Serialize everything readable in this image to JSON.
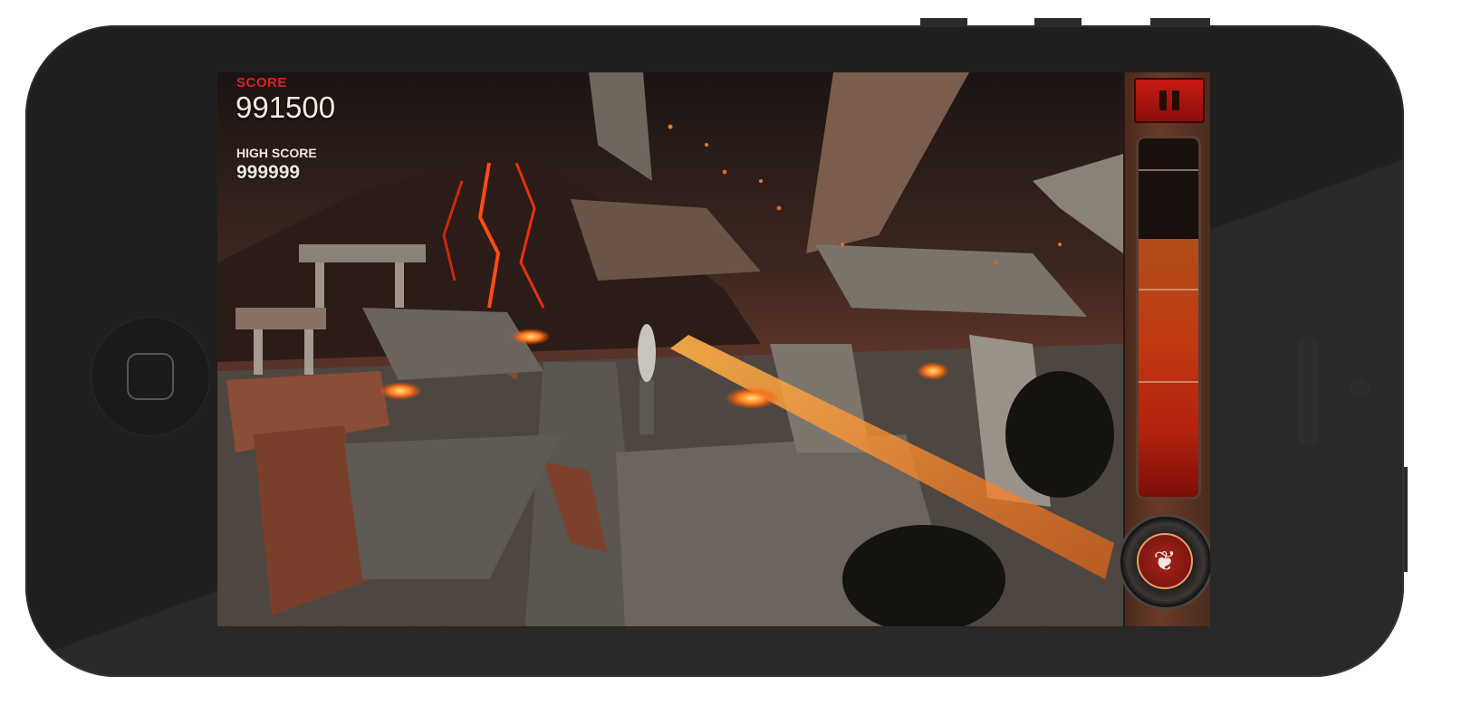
{
  "hud": {
    "score_label": "SCORE",
    "score": "991500",
    "high_score_label": "HIGH SCORE",
    "high_score": "999999"
  },
  "controls": {
    "pause_icon": "pause-icon",
    "special_icon": "fire-icon"
  },
  "lava_gauge": {
    "level": 0.72
  },
  "colors": {
    "score_label": "#e0201a",
    "hud_text": "#f1ebe3",
    "pause_button": "#c71a13",
    "lava": "#c13a12"
  }
}
